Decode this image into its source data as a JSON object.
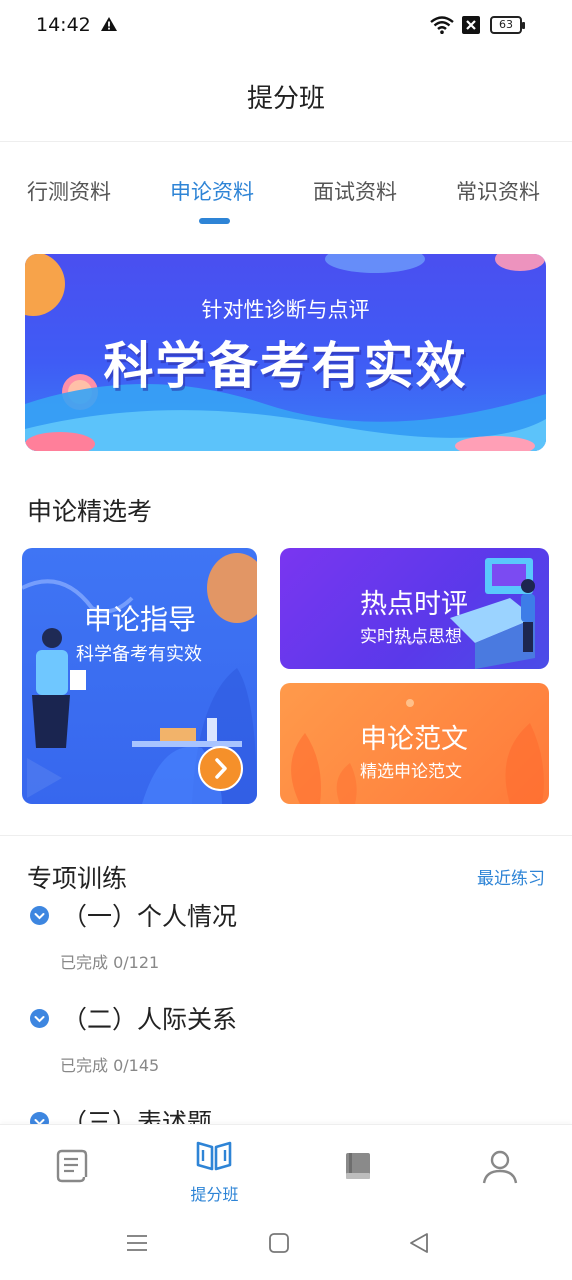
{
  "status_bar": {
    "time": "14:42",
    "battery": "63"
  },
  "page": {
    "title": "提分班"
  },
  "tabs": [
    {
      "label": "行测资料",
      "active": false
    },
    {
      "label": "申论资料",
      "active": true
    },
    {
      "label": "面试资料",
      "active": false
    },
    {
      "label": "常识资料",
      "active": false
    }
  ],
  "banner": {
    "subtitle": "针对性诊断与点评",
    "title": "科学备考有实效"
  },
  "section": {
    "title": "申论精选考"
  },
  "cards": {
    "guide": {
      "title": "申论指导",
      "subtitle": "科学备考有实效"
    },
    "hot": {
      "title": "热点时评",
      "subtitle": "实时热点思想"
    },
    "essay": {
      "title": "申论范文",
      "subtitle": "精选申论范文"
    }
  },
  "training": {
    "title": "专项训练",
    "recent_link": "最近练习",
    "items": [
      {
        "name": "（一）个人情况",
        "progress": "已完成 0/121"
      },
      {
        "name": "（二）人际关系",
        "progress": "已完成 0/145"
      },
      {
        "name": "（三）表述题",
        "progress": ""
      }
    ]
  },
  "bottom_nav": {
    "items": [
      {
        "icon": "scroll-icon",
        "label": ""
      },
      {
        "icon": "open-book-icon",
        "label": "提分班"
      },
      {
        "icon": "book-icon",
        "label": ""
      },
      {
        "icon": "user-icon",
        "label": ""
      }
    ]
  },
  "colors": {
    "accent": "#2e84d6",
    "banner": "#4a4ff0",
    "hot_card": "#6a38ee",
    "essay_card": "#ff8a40",
    "guide_card": "#3f75f4"
  }
}
